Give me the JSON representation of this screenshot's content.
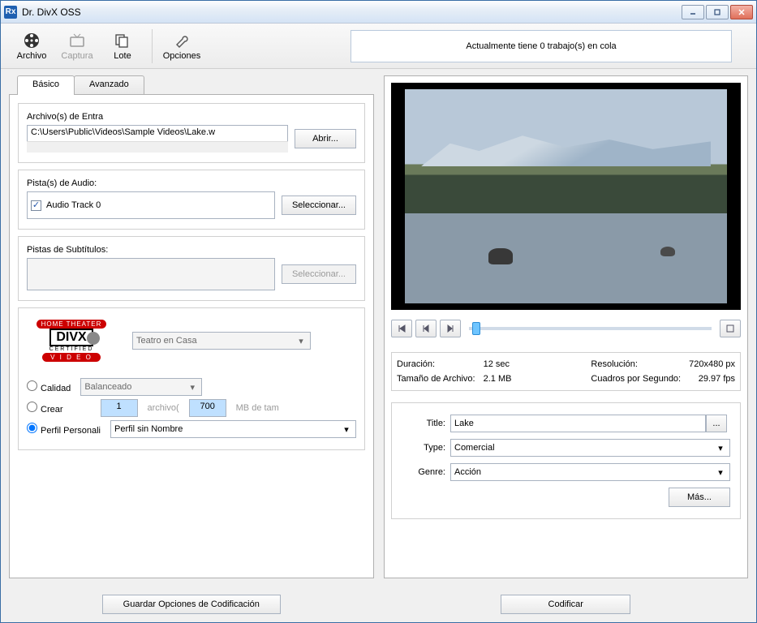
{
  "title": "Dr. DivX OSS",
  "toolbar": {
    "archivo": "Archivo",
    "captura": "Captura",
    "lote": "Lote",
    "opciones": "Opciones"
  },
  "queue_status": "Actualmente tiene 0 trabajo(s) en cola",
  "tabs": {
    "basico": "Básico",
    "avanzado": "Avanzado"
  },
  "input": {
    "label": "Archivo(s) de Entra",
    "value": "C:\\Users\\Public\\Videos\\Sample Videos\\Lake.w",
    "open_btn": "Abrir..."
  },
  "audio": {
    "label": "Pista(s) de Audio:",
    "track": "Audio Track 0",
    "select_btn": "Seleccionar..."
  },
  "subs": {
    "label": "Pistas de Subtítulos:",
    "select_btn": "Seleccionar..."
  },
  "profile": {
    "preset": "Teatro en Casa",
    "quality_label": "Calidad",
    "quality_value": "Balanceado",
    "create_label": "Crear",
    "create_files": "1",
    "create_unit": "archivo(",
    "create_size": "700",
    "create_size_unit": "MB de tam",
    "custom_label": "Perfil Personali",
    "custom_value": "Perfil sin Nombre"
  },
  "buttons": {
    "save_encoding": "Guardar Opciones de Codificación",
    "encode": "Codificar",
    "more": "Más..."
  },
  "info": {
    "duration_label": "Duración:",
    "duration": "12 sec",
    "filesize_label": "Tamaño de Archivo:",
    "filesize": "2.1 MB",
    "resolution_label": "Resolución:",
    "resolution": "720x480 px",
    "fps_label": "Cuadros por Segundo:",
    "fps": "29.97 fps"
  },
  "meta": {
    "title_label": "Title:",
    "title_value": "Lake",
    "type_label": "Type:",
    "type_value": "Comercial",
    "genre_label": "Genre:",
    "genre_value": "Acción"
  }
}
